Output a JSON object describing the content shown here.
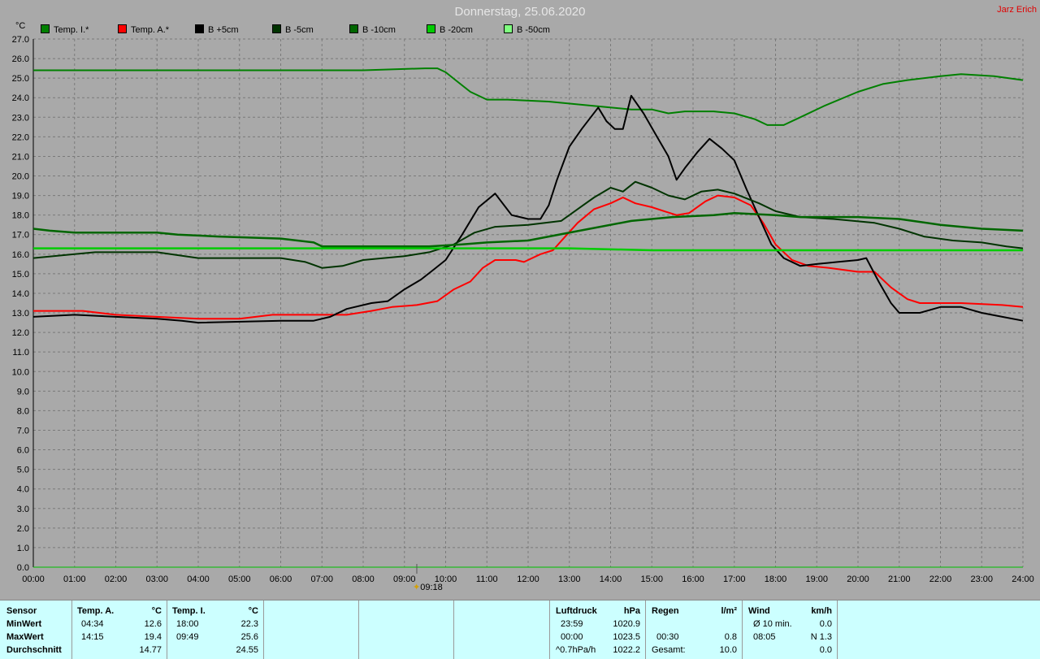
{
  "header": {
    "title": "Donnerstag, 25.06.2020",
    "author": "Jarz Erich",
    "unit": "°C",
    "marker_time": "09:18"
  },
  "colors": {
    "background": "#a9a9a9",
    "grid": "#7a7a7a",
    "stats_bg": "#ccffff",
    "temp_i": "#008000",
    "temp_a": "#ff0000",
    "b5": "#000000",
    "b_5": "#003300",
    "b_10": "#006600",
    "b_20": "#00cc00",
    "b_50": "#80ff80"
  },
  "chart_data": {
    "type": "line",
    "title": "Donnerstag, 25.06.2020",
    "xlabel": "",
    "ylabel": "°C",
    "xlim": [
      0,
      24
    ],
    "ylim": [
      0,
      27
    ],
    "grid": true,
    "legend": "top-left",
    "x_ticks": [
      "00:00",
      "01:00",
      "02:00",
      "03:00",
      "04:00",
      "05:00",
      "06:00",
      "07:00",
      "08:00",
      "09:00",
      "10:00",
      "11:00",
      "12:00",
      "13:00",
      "14:00",
      "15:00",
      "16:00",
      "17:00",
      "18:00",
      "19:00",
      "20:00",
      "21:00",
      "22:00",
      "23:00",
      "24:00"
    ],
    "y_ticks": [
      "0.0",
      "1.0",
      "2.0",
      "3.0",
      "4.0",
      "5.0",
      "6.0",
      "7.0",
      "8.0",
      "9.0",
      "10.0",
      "11.0",
      "12.0",
      "13.0",
      "14.0",
      "15.0",
      "16.0",
      "17.0",
      "18.0",
      "19.0",
      "20.0",
      "21.0",
      "22.0",
      "23.0",
      "24.0",
      "25.0",
      "26.0",
      "27.0"
    ],
    "series": [
      {
        "name": "Temp. I.*",
        "color": "#008000",
        "width": 2,
        "points": [
          [
            0,
            25.4
          ],
          [
            8,
            25.4
          ],
          [
            9.5,
            25.5
          ],
          [
            9.8,
            25.5
          ],
          [
            10,
            25.3
          ],
          [
            10.3,
            24.8
          ],
          [
            10.6,
            24.3
          ],
          [
            11,
            23.9
          ],
          [
            11.5,
            23.9
          ],
          [
            12.5,
            23.8
          ],
          [
            13.5,
            23.6
          ],
          [
            14.5,
            23.4
          ],
          [
            15,
            23.4
          ],
          [
            15.4,
            23.2
          ],
          [
            15.8,
            23.3
          ],
          [
            16.5,
            23.3
          ],
          [
            17,
            23.2
          ],
          [
            17.5,
            22.9
          ],
          [
            17.8,
            22.6
          ],
          [
            18.2,
            22.6
          ],
          [
            18.6,
            23.0
          ],
          [
            19.2,
            23.6
          ],
          [
            20,
            24.3
          ],
          [
            20.6,
            24.7
          ],
          [
            21.2,
            24.9
          ],
          [
            22,
            25.1
          ],
          [
            22.5,
            25.2
          ],
          [
            23.3,
            25.1
          ],
          [
            24,
            24.9
          ]
        ]
      },
      {
        "name": "Temp. A.*",
        "color": "#ff0000",
        "width": 2,
        "points": [
          [
            0,
            13.1
          ],
          [
            1.2,
            13.1
          ],
          [
            2,
            12.9
          ],
          [
            3,
            12.8
          ],
          [
            4,
            12.7
          ],
          [
            5,
            12.7
          ],
          [
            5.8,
            12.9
          ],
          [
            7,
            12.9
          ],
          [
            7.6,
            12.9
          ],
          [
            8.2,
            13.1
          ],
          [
            8.7,
            13.3
          ],
          [
            9.3,
            13.4
          ],
          [
            9.8,
            13.6
          ],
          [
            10.2,
            14.2
          ],
          [
            10.6,
            14.6
          ],
          [
            10.9,
            15.3
          ],
          [
            11.2,
            15.7
          ],
          [
            11.7,
            15.7
          ],
          [
            11.9,
            15.6
          ],
          [
            12.3,
            16.0
          ],
          [
            12.6,
            16.2
          ],
          [
            12.9,
            16.9
          ],
          [
            13.2,
            17.6
          ],
          [
            13.6,
            18.3
          ],
          [
            14,
            18.6
          ],
          [
            14.3,
            18.9
          ],
          [
            14.6,
            18.6
          ],
          [
            15,
            18.4
          ],
          [
            15.3,
            18.2
          ],
          [
            15.6,
            18.0
          ],
          [
            15.9,
            18.1
          ],
          [
            16.3,
            18.7
          ],
          [
            16.6,
            19.0
          ],
          [
            17,
            18.9
          ],
          [
            17.4,
            18.5
          ],
          [
            17.7,
            17.6
          ],
          [
            18,
            16.5
          ],
          [
            18.4,
            15.7
          ],
          [
            18.8,
            15.4
          ],
          [
            19.3,
            15.3
          ],
          [
            20,
            15.1
          ],
          [
            20.4,
            15.1
          ],
          [
            20.8,
            14.3
          ],
          [
            21.2,
            13.7
          ],
          [
            21.5,
            13.5
          ],
          [
            22.5,
            13.5
          ],
          [
            23.5,
            13.4
          ],
          [
            24,
            13.3
          ]
        ]
      },
      {
        "name": "B +5cm",
        "color": "#000000",
        "width": 2,
        "points": [
          [
            0,
            12.8
          ],
          [
            1,
            12.9
          ],
          [
            2,
            12.8
          ],
          [
            3,
            12.7
          ],
          [
            3.6,
            12.6
          ],
          [
            4,
            12.5
          ],
          [
            6,
            12.6
          ],
          [
            6.8,
            12.6
          ],
          [
            7.2,
            12.8
          ],
          [
            7.6,
            13.2
          ],
          [
            8.2,
            13.5
          ],
          [
            8.6,
            13.6
          ],
          [
            9,
            14.2
          ],
          [
            9.4,
            14.7
          ],
          [
            9.7,
            15.2
          ],
          [
            10,
            15.7
          ],
          [
            10.4,
            17.0
          ],
          [
            10.8,
            18.4
          ],
          [
            11.2,
            19.1
          ],
          [
            11.6,
            18.0
          ],
          [
            12,
            17.8
          ],
          [
            12.3,
            17.8
          ],
          [
            12.5,
            18.5
          ],
          [
            12.7,
            19.8
          ],
          [
            13,
            21.5
          ],
          [
            13.3,
            22.4
          ],
          [
            13.7,
            23.5
          ],
          [
            13.9,
            22.8
          ],
          [
            14.1,
            22.4
          ],
          [
            14.3,
            22.4
          ],
          [
            14.5,
            24.1
          ],
          [
            14.8,
            23.2
          ],
          [
            15.1,
            22.1
          ],
          [
            15.4,
            21.0
          ],
          [
            15.6,
            19.8
          ],
          [
            15.8,
            20.4
          ],
          [
            16.1,
            21.2
          ],
          [
            16.4,
            21.9
          ],
          [
            16.7,
            21.4
          ],
          [
            17,
            20.8
          ],
          [
            17.3,
            19.3
          ],
          [
            17.6,
            17.9
          ],
          [
            17.9,
            16.5
          ],
          [
            18.2,
            15.8
          ],
          [
            18.6,
            15.4
          ],
          [
            19,
            15.5
          ],
          [
            19.5,
            15.6
          ],
          [
            20,
            15.7
          ],
          [
            20.2,
            15.8
          ],
          [
            20.5,
            14.6
          ],
          [
            20.8,
            13.5
          ],
          [
            21,
            13.0
          ],
          [
            21.5,
            13.0
          ],
          [
            22,
            13.3
          ],
          [
            22.5,
            13.3
          ],
          [
            23,
            13.0
          ],
          [
            23.5,
            12.8
          ],
          [
            24,
            12.6
          ]
        ]
      },
      {
        "name": "B -5cm",
        "color": "#003300",
        "width": 2,
        "points": [
          [
            0,
            15.8
          ],
          [
            1,
            16.0
          ],
          [
            1.5,
            16.1
          ],
          [
            3,
            16.1
          ],
          [
            4,
            15.8
          ],
          [
            6,
            15.8
          ],
          [
            6.6,
            15.6
          ],
          [
            7,
            15.3
          ],
          [
            7.5,
            15.4
          ],
          [
            8,
            15.7
          ],
          [
            9,
            15.9
          ],
          [
            9.6,
            16.1
          ],
          [
            10.2,
            16.5
          ],
          [
            10.7,
            17.1
          ],
          [
            11.2,
            17.4
          ],
          [
            12,
            17.5
          ],
          [
            12.8,
            17.7
          ],
          [
            13.2,
            18.3
          ],
          [
            13.6,
            18.9
          ],
          [
            14,
            19.4
          ],
          [
            14.3,
            19.2
          ],
          [
            14.6,
            19.7
          ],
          [
            15,
            19.4
          ],
          [
            15.4,
            19.0
          ],
          [
            15.8,
            18.8
          ],
          [
            16.2,
            19.2
          ],
          [
            16.6,
            19.3
          ],
          [
            17,
            19.1
          ],
          [
            17.6,
            18.6
          ],
          [
            18,
            18.2
          ],
          [
            18.6,
            17.9
          ],
          [
            19.4,
            17.8
          ],
          [
            20.4,
            17.6
          ],
          [
            21,
            17.3
          ],
          [
            21.6,
            16.9
          ],
          [
            22.3,
            16.7
          ],
          [
            23,
            16.6
          ],
          [
            23.6,
            16.4
          ],
          [
            24,
            16.3
          ]
        ]
      },
      {
        "name": "B -10cm",
        "color": "#006600",
        "width": 2.5,
        "points": [
          [
            0,
            17.3
          ],
          [
            0.4,
            17.2
          ],
          [
            1,
            17.1
          ],
          [
            3,
            17.1
          ],
          [
            3.5,
            17.0
          ],
          [
            4.5,
            16.9
          ],
          [
            6,
            16.8
          ],
          [
            6.8,
            16.6
          ],
          [
            7,
            16.4
          ],
          [
            8,
            16.4
          ],
          [
            9.6,
            16.4
          ],
          [
            10.4,
            16.5
          ],
          [
            11,
            16.6
          ],
          [
            12,
            16.7
          ],
          [
            12.5,
            16.9
          ],
          [
            13.5,
            17.3
          ],
          [
            14.5,
            17.7
          ],
          [
            15.5,
            17.9
          ],
          [
            16.5,
            18.0
          ],
          [
            17,
            18.1
          ],
          [
            18,
            18.0
          ],
          [
            18.6,
            17.9
          ],
          [
            20,
            17.9
          ],
          [
            21,
            17.8
          ],
          [
            22,
            17.5
          ],
          [
            23,
            17.3
          ],
          [
            24,
            17.2
          ]
        ]
      },
      {
        "name": "B -20cm",
        "color": "#00cc00",
        "width": 2.5,
        "points": [
          [
            0,
            16.3
          ],
          [
            6,
            16.3
          ],
          [
            9.5,
            16.3
          ],
          [
            10.5,
            16.3
          ],
          [
            13,
            16.3
          ],
          [
            15,
            16.2
          ],
          [
            15.5,
            16.2
          ],
          [
            16,
            16.2
          ],
          [
            20,
            16.2
          ],
          [
            24,
            16.2
          ]
        ]
      },
      {
        "name": "B -50cm",
        "color": "#80ff80",
        "width": 2,
        "points": []
      }
    ]
  },
  "stats": {
    "sensor": {
      "header": "Sensor",
      "min": "MinWert",
      "max": "MaxWert",
      "avg": "Durchschnitt"
    },
    "temp_a": {
      "header": "Temp. A.",
      "unit": "°C",
      "min_time": "04:34",
      "min_val": "12.6",
      "max_time": "14:15",
      "max_val": "19.4",
      "avg": "14.77"
    },
    "temp_i": {
      "header": "Temp. I.",
      "unit": "°C",
      "min_time": "18:00",
      "min_val": "22.3",
      "max_time": "09:49",
      "max_val": "25.6",
      "avg": "24.55"
    },
    "pressure": {
      "header": "Luftdruck",
      "unit": "hPa",
      "r1_label": "23:59",
      "r1_val": "1020.9",
      "r2_label": "00:00",
      "r2_val": "1023.5",
      "r3_label": "^0.7hPa/h",
      "r3_val": "1022.2"
    },
    "rain": {
      "header": "Regen",
      "unit": "l/m²",
      "r2_label": "00:30",
      "r2_val": "0.8",
      "r3_label": "Gesamt:",
      "r3_val": "10.0"
    },
    "wind": {
      "header": "Wind",
      "unit": "km/h",
      "r1_label": "Ø 10 min.",
      "r1_val": "0.0",
      "r2_label": "08:05",
      "r2_val": "N 1.3",
      "r3_val": "0.0"
    }
  }
}
